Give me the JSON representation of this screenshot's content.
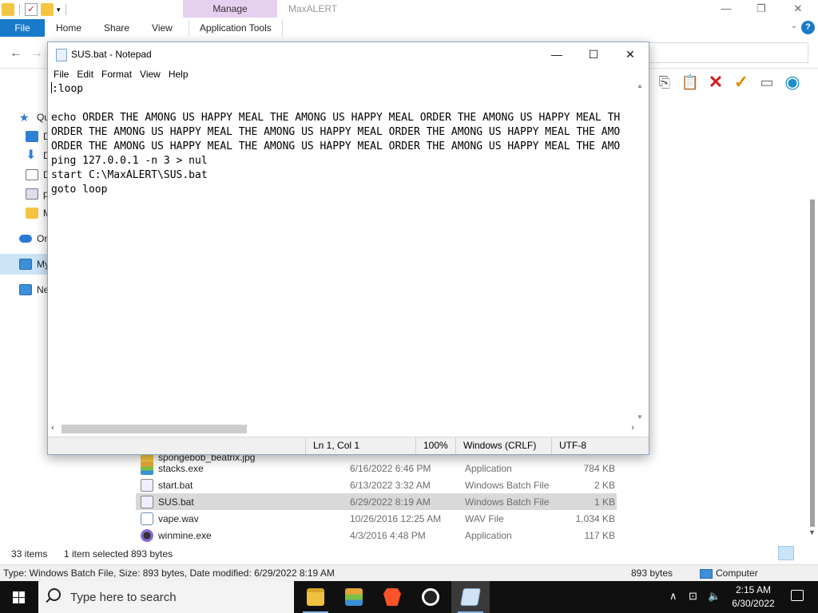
{
  "explorer": {
    "ribbon": {
      "contextual_tab": "Manage",
      "window_title": "MaxALERT",
      "tabs": [
        "File",
        "Home",
        "Share",
        "View",
        "Application Tools"
      ]
    },
    "nav_pane": {
      "items": [
        "Qu",
        "D",
        "D",
        "D",
        "p",
        "M",
        "On",
        "My",
        "Ne"
      ]
    },
    "files": [
      {
        "name": "spongebob_beatrix.jpg",
        "date": "",
        "type": "",
        "size": "",
        "icon": "image-icon"
      },
      {
        "name": "stacks.exe",
        "date": "6/16/2022 6:46 PM",
        "type": "Application",
        "size": "784 KB",
        "icon": "stacks-icon"
      },
      {
        "name": "start.bat",
        "date": "6/13/2022 3:32 AM",
        "type": "Windows Batch File",
        "size": "2 KB",
        "icon": "batch-file-icon"
      },
      {
        "name": "SUS.bat",
        "date": "6/29/2022 8:19 AM",
        "type": "Windows Batch File",
        "size": "1 KB",
        "icon": "batch-file-icon"
      },
      {
        "name": "vape.wav",
        "date": "10/26/2016 12:25 AM",
        "type": "WAV File",
        "size": "1,034 KB",
        "icon": "wav-file-icon"
      },
      {
        "name": "winmine.exe",
        "date": "4/3/2016 4:48 PM",
        "type": "Application",
        "size": "117 KB",
        "icon": "winmine-icon"
      }
    ],
    "status": {
      "item_count": "33 items",
      "selection": "1 item selected",
      "selection_size": "893 bytes"
    },
    "details_bar": {
      "info": "Type: Windows Batch File, Size: 893 bytes, Date modified: 6/29/2022 8:19 AM",
      "size": "893 bytes",
      "location": "Computer"
    }
  },
  "notepad": {
    "title": "SUS.bat - Notepad",
    "menu": [
      "File",
      "Edit",
      "Format",
      "View",
      "Help"
    ],
    "lines": [
      ":loop",
      "",
      "echo ORDER THE AMONG US HAPPY MEAL THE AMONG US HAPPY MEAL ORDER THE AMONG US HAPPY MEAL TH",
      "ORDER THE AMONG US HAPPY MEAL THE AMONG US HAPPY MEAL ORDER THE AMONG US HAPPY MEAL THE AMO",
      "ORDER THE AMONG US HAPPY MEAL THE AMONG US HAPPY MEAL ORDER THE AMONG US HAPPY MEAL THE AMO",
      "ping 127.0.0.1 -n 3 > nul",
      "start C:\\MaxALERT\\SUS.bat",
      "goto loop"
    ],
    "status": {
      "position": "Ln 1, Col 1",
      "zoom": "100%",
      "line_endings": "Windows (CRLF)",
      "encoding": "UTF-8"
    }
  },
  "taskbar": {
    "search_placeholder": "Type here to search",
    "time": "2:15 AM",
    "date": "6/30/2022"
  }
}
